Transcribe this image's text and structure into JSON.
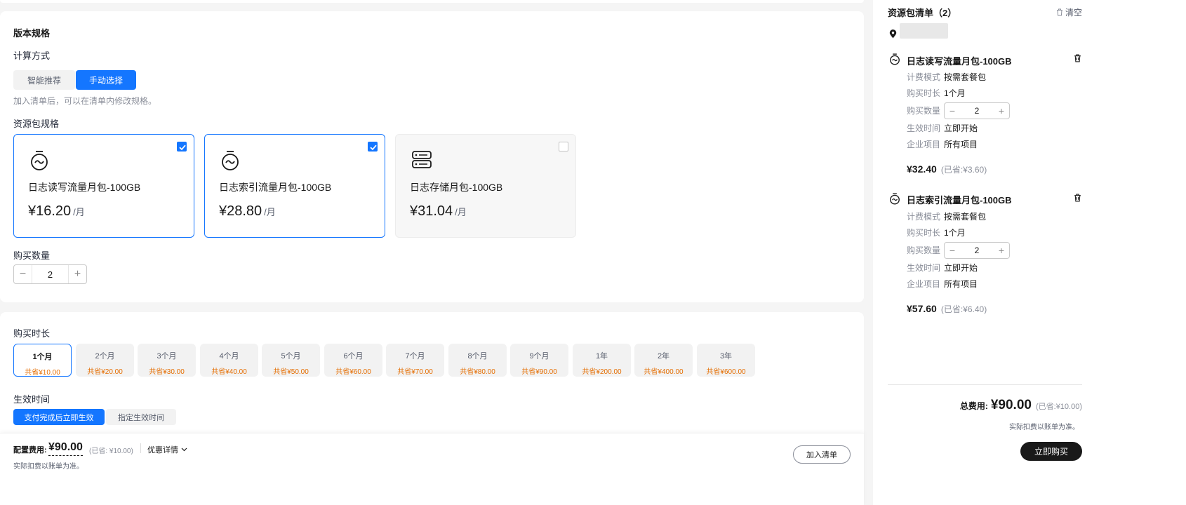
{
  "spec": {
    "section_title": "版本规格",
    "calc_label": "计算方式",
    "calc_options": [
      "智能推荐",
      "手动选择"
    ],
    "calc_selected": "手动选择",
    "hint": "加入清单后，可以在清单内修改规格。",
    "package_label": "资源包规格",
    "packages": [
      {
        "name": "日志读写流量月包-100GB",
        "price": "¥16.20",
        "unit": "/月",
        "checked": true,
        "icon": "timer-wave-icon"
      },
      {
        "name": "日志索引流量月包-100GB",
        "price": "¥28.80",
        "unit": "/月",
        "checked": true,
        "icon": "timer-wave-icon"
      },
      {
        "name": "日志存储月包-100GB",
        "price": "¥31.04",
        "unit": "/月",
        "checked": false,
        "icon": "server-storage-icon"
      }
    ],
    "quantity_label": "购买数量",
    "quantity_value": "2",
    "quantity_minus": "−",
    "quantity_plus": "+"
  },
  "purchase": {
    "duration_label": "购买时长",
    "durations": [
      {
        "label": "1个月",
        "save": "共省¥10.00",
        "selected": true
      },
      {
        "label": "2个月",
        "save": "共省¥20.00"
      },
      {
        "label": "3个月",
        "save": "共省¥30.00"
      },
      {
        "label": "4个月",
        "save": "共省¥40.00"
      },
      {
        "label": "5个月",
        "save": "共省¥50.00"
      },
      {
        "label": "6个月",
        "save": "共省¥60.00"
      },
      {
        "label": "7个月",
        "save": "共省¥70.00"
      },
      {
        "label": "8个月",
        "save": "共省¥80.00"
      },
      {
        "label": "9个月",
        "save": "共省¥90.00"
      },
      {
        "label": "1年",
        "save": "共省¥200.00"
      },
      {
        "label": "2年",
        "save": "共省¥400.00"
      },
      {
        "label": "3年",
        "save": "共省¥600.00"
      }
    ],
    "effective_label": "生效时间",
    "effective_options": [
      "支付完成后立即生效",
      "指定生效时间"
    ],
    "effective_selected": "支付完成后立即生效"
  },
  "footer": {
    "fee_label": "配置费用:",
    "fee_value": "¥90.00",
    "fee_saved": "(已省: ¥10.00)",
    "discount_link": "优惠详情",
    "note": "实际扣费以账单为准。",
    "add_button": "加入清单"
  },
  "cart": {
    "title": "资源包清单（2）",
    "clear_label": "清空",
    "items": [
      {
        "name": "日志读写流量月包-100GB",
        "billing_key": "计费模式",
        "billing_val": "按需套餐包",
        "duration_key": "购买时长",
        "duration_val": "1个月",
        "qty_key": "购买数量",
        "qty_val": "2",
        "effective_key": "生效时间",
        "effective_val": "立即开始",
        "project_key": "企业项目",
        "project_val": "所有项目",
        "price": "¥32.40",
        "saved": "(已省:¥3.60)"
      },
      {
        "name": "日志索引流量月包-100GB",
        "billing_key": "计费模式",
        "billing_val": "按需套餐包",
        "duration_key": "购买时长",
        "duration_val": "1个月",
        "qty_key": "购买数量",
        "qty_val": "2",
        "effective_key": "生效时间",
        "effective_val": "立即开始",
        "project_key": "企业项目",
        "project_val": "所有项目",
        "price": "¥57.60",
        "saved": "(已省:¥6.40)"
      }
    ],
    "total_label": "总费用:",
    "total_value": "¥90.00",
    "total_saved": "(已省:¥10.00)",
    "note": "实际扣费以账单为准。",
    "buy_button": "立即购买"
  },
  "colors": {
    "accent": "#1476ff",
    "saving": "#e56d00",
    "buy_button": "#191919"
  }
}
